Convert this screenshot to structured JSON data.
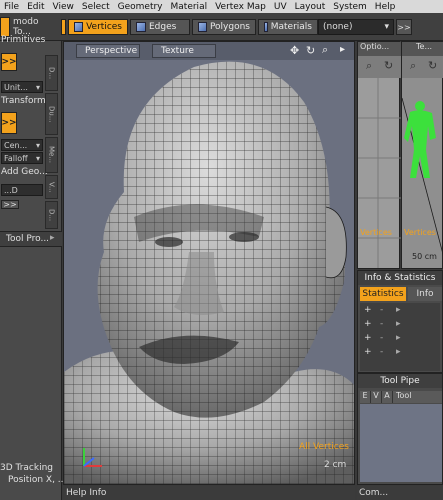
{
  "menu": [
    "File",
    "Edit",
    "View",
    "Select",
    "Geometry",
    "Material",
    "Vertex Map",
    "UV",
    "Layout",
    "System",
    "Help"
  ],
  "toolbar": {
    "layout_name": "modo To...",
    "vertices": "Vertices",
    "edges": "Edges",
    "polygons": "Polygons",
    "materials": "Materials",
    "selection_value": "(none)",
    "expand": ">>"
  },
  "left": {
    "primitives": "Primitives",
    "expand": ">>",
    "unit_value": "Unit...",
    "transform": "Transform",
    "center_value": "Cen...",
    "falloff_value": "Falloff",
    "add_geo": "Add Geo...",
    "geo_value": "...D",
    "tool_pro": "Tool Pro...",
    "tracking_line1": "3D Tracking",
    "tracking_line2": "Position X, ..."
  },
  "viewport": {
    "view_mode": "Perspective",
    "shading": "Texture",
    "selection_info": "All Vertices",
    "scale": "2 cm"
  },
  "mini_views": {
    "left_title": "Optio...",
    "right_title": "Te...",
    "left_label": "Vertices",
    "right_label": "Vertices",
    "scale": "50 cm"
  },
  "info_panel": {
    "title": "Info & Statistics",
    "tab_statistics": "Statistics",
    "tab_info": "Info",
    "rows": [
      "+",
      "+",
      "+",
      "+"
    ]
  },
  "tool_pipe": {
    "title": "Tool Pipe",
    "columns": [
      "E",
      "V",
      "A",
      "Tool"
    ]
  },
  "status": {
    "help_info": "Help Info",
    "command": "Com..."
  },
  "colors": {
    "accent": "#f3a21c",
    "viewport_bg": "#6b7080",
    "panel_bg": "#4a4a4a"
  }
}
